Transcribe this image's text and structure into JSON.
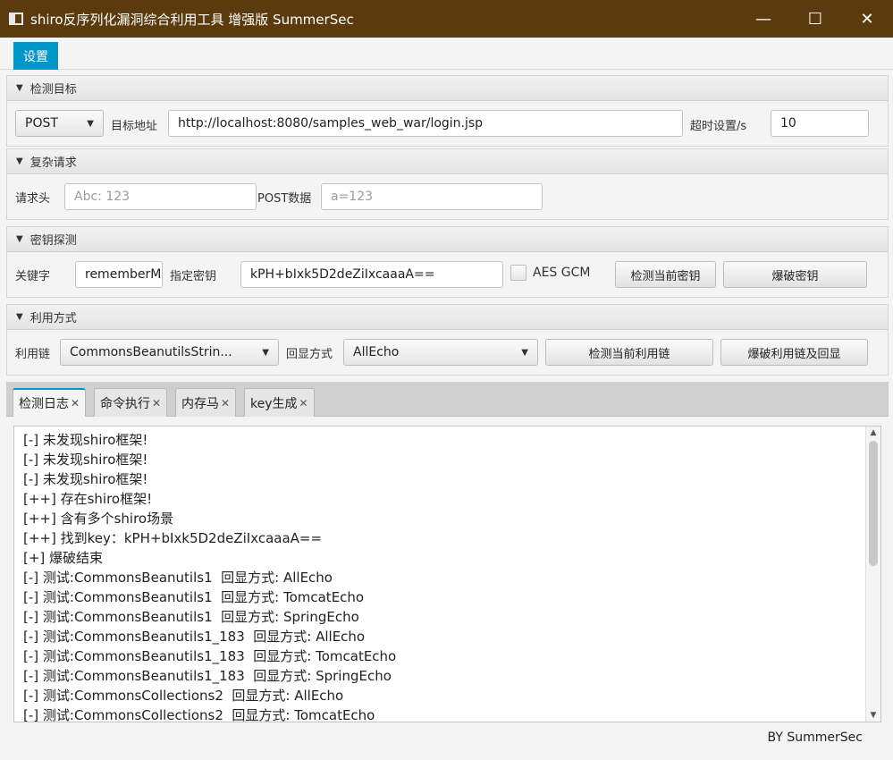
{
  "window": {
    "title": "shiro反序列化漏洞综合利用工具 增强版 SummerSec",
    "minimize": "—",
    "maximize": "☐",
    "close": "✕"
  },
  "menu": {
    "settings": "设置"
  },
  "target": {
    "header": "检测目标",
    "method": "POST",
    "url_label": "目标地址",
    "url": "http://localhost:8080/samples_web_war/login.jsp",
    "timeout_label": "超时设置/s",
    "timeout": "10"
  },
  "complex": {
    "header": "复杂请求",
    "headers_label": "请求头",
    "headers_placeholder": "Abc: 123",
    "post_label": "POST数据",
    "post_placeholder": "a=123"
  },
  "key": {
    "header": "密钥探测",
    "keyword_label": "关键字",
    "keyword": "rememberM",
    "key_label": "指定密钥",
    "key_value": "kPH+bIxk5D2deZiIxcaaaA==",
    "aes_gcm": "AES GCM",
    "check_button": "检测当前密钥",
    "brute_button": "爆破密钥"
  },
  "exploit": {
    "header": "利用方式",
    "chain_label": "利用链",
    "chain": "CommonsBeanutilsStrin...",
    "echo_label": "回显方式",
    "echo": "AllEcho",
    "check_button": "检测当前利用链",
    "brute_button": "爆破利用链及回显"
  },
  "tabs": [
    {
      "label": "检测日志"
    },
    {
      "label": "命令执行"
    },
    {
      "label": "内存马"
    },
    {
      "label": "key生成"
    }
  ],
  "tab_close": "✕",
  "log": [
    "[-] 未发现shiro框架!",
    "[-] 未发现shiro框架!",
    "[-] 未发现shiro框架!",
    "[++] 存在shiro框架!",
    "[++] 含有多个shiro场景",
    "[++] 找到key：kPH+bIxk5D2deZiIxcaaaA==",
    "[+] 爆破结束",
    "[-] 测试:CommonsBeanutils1  回显方式: AllEcho",
    "[-] 测试:CommonsBeanutils1  回显方式: TomcatEcho",
    "[-] 测试:CommonsBeanutils1  回显方式: SpringEcho",
    "[-] 测试:CommonsBeanutils1_183  回显方式: AllEcho",
    "[-] 测试:CommonsBeanutils1_183  回显方式: TomcatEcho",
    "[-] 测试:CommonsBeanutils1_183  回显方式: SpringEcho",
    "[-] 测试:CommonsCollections2  回显方式: AllEcho",
    "[-] 测试:CommonsCollections2  回显方式: TomcatEcho"
  ],
  "footer": "BY   SummerSec"
}
